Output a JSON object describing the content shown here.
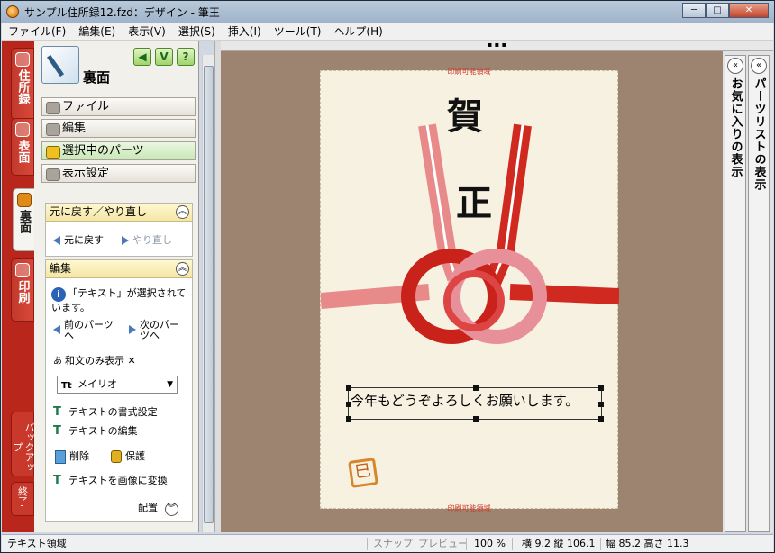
{
  "window": {
    "title": "サンプル住所録12.fzd：デザイン - 筆王",
    "minimize_label": "─",
    "maximize_label": "□",
    "close_label": "✕"
  },
  "menu": [
    "ファイル(F)",
    "編集(E)",
    "表示(V)",
    "選択(S)",
    "挿入(I)",
    "ツール(T)",
    "ヘルプ(H)"
  ],
  "left_tabs": {
    "address": "住所録",
    "front": "表面",
    "back": "裏面",
    "print": "印刷",
    "backup": "バックアップ",
    "exit": "終了"
  },
  "panel": {
    "title": "裏面",
    "help_label": "?",
    "buttons": [
      "ファイル",
      "編集",
      "選択中のパーツ",
      "表示設定"
    ],
    "undo_box": {
      "header": "元に戻す／やり直し",
      "undo": "元に戻す",
      "redo": "やり直し"
    },
    "edit_box": {
      "header": "編集",
      "info": "「テキスト」が選択されています。",
      "prev": "前のパーツへ",
      "next": "次のパーツへ",
      "wabun": "和文のみ表示",
      "wabun_icon_text": "あ",
      "wabun_close": "✕",
      "font_icon_text": "Tt",
      "font": "メイリオ",
      "format": "テキストの書式設定",
      "edit": "テキストの編集",
      "delete": "削除",
      "protect": "保護",
      "to_image": "テキストを画像に変換",
      "arrange": "配置"
    }
  },
  "canvas": {
    "print_area_top": "印刷可能領域",
    "print_area_bottom": "印刷可能領域",
    "cap_char_1": "賀",
    "cap_char_2": "正",
    "message": "今年もどうぞよろしくお願いします。",
    "stamp_char": "巳"
  },
  "right_panes": {
    "favorites": "お気に入りの表示",
    "parts_list": "パーツリストの表示"
  },
  "status": {
    "mode": "テキスト領域",
    "snap": "スナップ",
    "preview": "プレビュー",
    "zoom": "100 %",
    "position": "横 9.2 縦 106.1",
    "size": "幅 85.2 高さ 11.3"
  }
}
